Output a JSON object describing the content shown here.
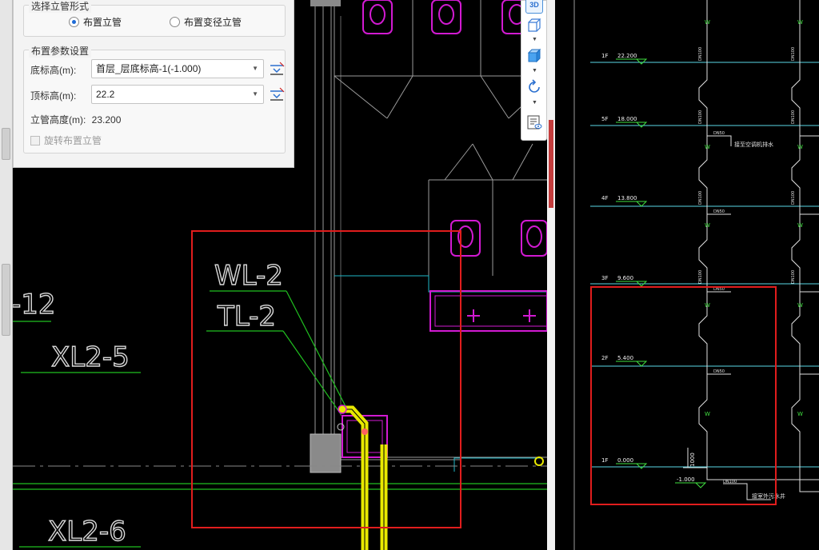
{
  "panel": {
    "section1_title": "选择立管形式",
    "radio_option1": "布置立管",
    "radio_option2": "布置变径立管",
    "section2_title": "布置参数设置",
    "bottom_elev_label": "底标高(m):",
    "bottom_elev_value": "首层_层底标高-1(-1.000)",
    "top_elev_label": "顶标高(m):",
    "top_elev_value": "22.2",
    "pipe_height_label": "立管高度(m):",
    "pipe_height_value": "23.200",
    "rotate_label": "旋转布置立管"
  },
  "viewbar": {
    "btn_3d": "3D"
  },
  "cad_left": {
    "label_12": "-12",
    "label_xl25": "XL2-5",
    "label_wl2": "WL-2",
    "label_tl2": "TL-2",
    "label_xl26": "XL2-6"
  },
  "cad_right": {
    "floors": [
      {
        "floor": "1F",
        "elev": "22.200"
      },
      {
        "floor": "5F",
        "elev": "18.000"
      },
      {
        "floor": "4F",
        "elev": "13.800"
      },
      {
        "floor": "3F",
        "elev": "9.600"
      },
      {
        "floor": "2F",
        "elev": "5.400"
      },
      {
        "floor": "1F",
        "elev": "0.000"
      }
    ],
    "base_elev": "-1.000",
    "dim_1000": "1000",
    "note1": "接至空调机排水",
    "note2": "接室外污水井"
  },
  "colors": {
    "highlight_red": "#e11d1d",
    "pipe_yellow": "#e8e800",
    "fixture_magenta": "#d21ad2",
    "line_green": "#20c020",
    "line_cyan": "#1fb8c8"
  }
}
